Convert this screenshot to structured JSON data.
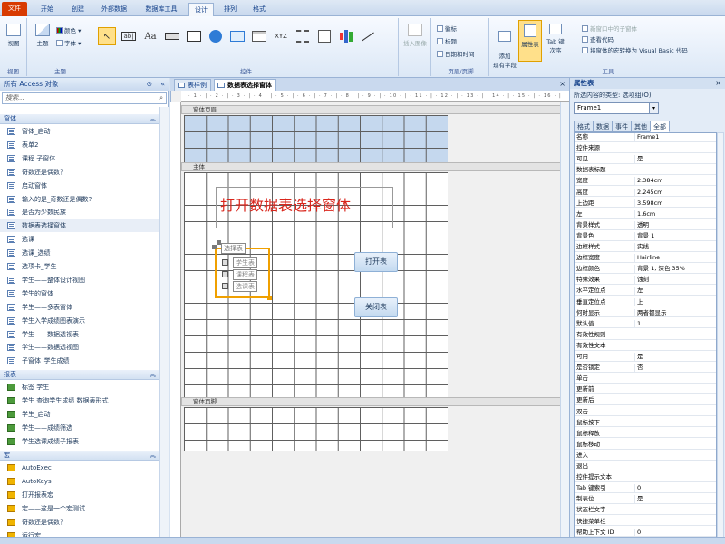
{
  "ribbon_tabs": [
    "文件",
    "开始",
    "创建",
    "外部数据",
    "数据库工具",
    "设计",
    "排列",
    "格式"
  ],
  "ribbon": {
    "views": {
      "label": "视图",
      "group": "视图"
    },
    "theme": {
      "theme_label": "主题",
      "colors": "颜色",
      "fonts": "字体",
      "group": "主题"
    },
    "controls_group": "控件",
    "controls": [
      "select-tool",
      "text-box",
      "label",
      "button",
      "tab-control",
      "hyperlink",
      "web-browser",
      "navigation",
      "option-group",
      "page-break",
      "combo-box",
      "chart",
      "line"
    ],
    "insert_image": "插入图像",
    "header_footer": {
      "logo": "徽标",
      "title": "标题",
      "datetime": "日期和时间",
      "group": "页眉/页脚"
    },
    "tools": {
      "add_fields": "添加\n现有字段",
      "property_sheet": "属性表",
      "tab_order": "Tab 键次序",
      "new_window": "新窗口中的子窗体",
      "view_code": "查看代码",
      "convert_macros": "将窗体的宏转换为 Visual Basic 代码",
      "group": "工具"
    }
  },
  "nav": {
    "header": "所有 Access 对象",
    "search_placeholder": "搜索...",
    "sections": [
      {
        "name": "窗体",
        "items": [
          "窗体_启动",
          "表单2",
          "课程 子窗体",
          "奇数还是偶数？",
          "启动窗体",
          "输入的是_奇数还是偶数?",
          "是否为少数民族",
          "数据表选择窗体",
          "选课",
          "选课_选绩",
          "选项卡_学生",
          "学生——整体设计视图",
          "学生的窗体",
          "学生——多表窗体",
          "学生入学成绩图表演示",
          "学生——数据透视表",
          "学生——数据透视图",
          "子窗体_学生成绩"
        ]
      },
      {
        "name": "报表",
        "items": [
          "标签 学生",
          "学生 查询学生成绩 数据表形式",
          "学生_启动",
          "学生——成绩筛选",
          "学生选课成绩子报表"
        ]
      },
      {
        "name": "宏",
        "items": [
          "AutoExec",
          "AutoKeys",
          "打开报表宏",
          "宏——这是一个宏测试",
          "奇数还是偶数？",
          "运行宏"
        ]
      }
    ]
  },
  "doc_tabs": [
    "表样例",
    "数据表选择窗体"
  ],
  "ruler_text": "· 1 · | · 2 · | · 3 · | · 4 · | · 5 · | · 6 · | · 7 · | · 8 · | · 9 · | · 10 · | · 11 · | · 12 · | · 13 · | · 14 · | · 15 · | · 16 · | · 17 · | · 18 · | · 19 ·",
  "sections": {
    "header": "窗体页眉",
    "detail": "主体",
    "footer": "窗体页脚"
  },
  "form": {
    "title_label": "打开数据表选择窗体",
    "frame_label": "选择表",
    "options": [
      "学生表",
      "课程表",
      "选课表"
    ],
    "open_button": "打开表",
    "close_button": "关闭表"
  },
  "props": {
    "title": "属性表",
    "selection_type": "所选内容的类型: 选项组(O)",
    "selected": "Frame1",
    "tabs": [
      "格式",
      "数据",
      "事件",
      "其他",
      "全部"
    ],
    "rows": [
      [
        "名称",
        "Frame1"
      ],
      [
        "控件来源",
        ""
      ],
      [
        "可见",
        "是"
      ],
      [
        "数据表标题",
        ""
      ],
      [
        "宽度",
        "2.384cm"
      ],
      [
        "高度",
        "2.245cm"
      ],
      [
        "上边距",
        "3.598cm"
      ],
      [
        "左",
        "1.6cm"
      ],
      [
        "背景样式",
        "透明"
      ],
      [
        "背景色",
        "背景 1"
      ],
      [
        "边框样式",
        "实线"
      ],
      [
        "边框宽度",
        "Hairline"
      ],
      [
        "边框颜色",
        "背景 1, 深色 35%"
      ],
      [
        "特殊效果",
        "蚀刻"
      ],
      [
        "水平定位点",
        "左"
      ],
      [
        "垂直定位点",
        "上"
      ],
      [
        "何时显示",
        "两者都显示"
      ],
      [
        "默认值",
        "1"
      ],
      [
        "有效性规则",
        ""
      ],
      [
        "有效性文本",
        ""
      ],
      [
        "可用",
        "是"
      ],
      [
        "是否锁定",
        "否"
      ],
      [
        "单击",
        ""
      ],
      [
        "更新前",
        ""
      ],
      [
        "更新后",
        ""
      ],
      [
        "双击",
        ""
      ],
      [
        "鼠标按下",
        ""
      ],
      [
        "鼠标释放",
        ""
      ],
      [
        "鼠标移动",
        ""
      ],
      [
        "进入",
        ""
      ],
      [
        "退出",
        ""
      ],
      [
        "控件提示文本",
        ""
      ],
      [
        "Tab 键索引",
        "0"
      ],
      [
        "制表位",
        "是"
      ],
      [
        "状态栏文字",
        ""
      ],
      [
        "快捷菜单栏",
        ""
      ],
      [
        "帮助上下文 ID",
        "0"
      ]
    ]
  }
}
